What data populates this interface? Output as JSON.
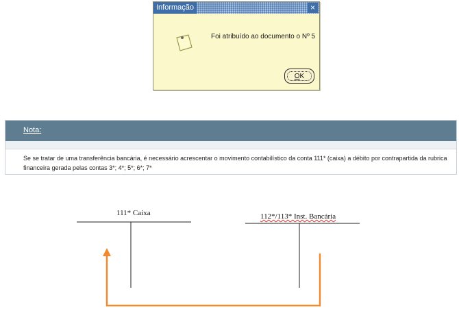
{
  "dialog": {
    "title": "Informação",
    "close_glyph": "×",
    "message": "Foi atribuído ao documento o Nº 5",
    "ok_label_prefix": "",
    "ok_label_mnemonic": "O",
    "ok_label_rest": "K",
    "icon": "note-icon"
  },
  "nota": {
    "title": "Nota:",
    "body": "Se se tratar de uma transferência bancária, é necessário acrescentar o movimento contabilístico da conta 111* (caixa) a débito por contrapartida da rubrica financeira gerada pelas contas 3*; 4*; 5*; 6*; 7*"
  },
  "diagram": {
    "left_account": "111* Caixa",
    "right_account": "112*/113* Inst. Bancária",
    "arrow_color": "#f08a30"
  },
  "colors": {
    "dialog_bg": "#fbf8cc",
    "titlebar": "#3f6ea8",
    "nota_header": "#5f7d91"
  }
}
